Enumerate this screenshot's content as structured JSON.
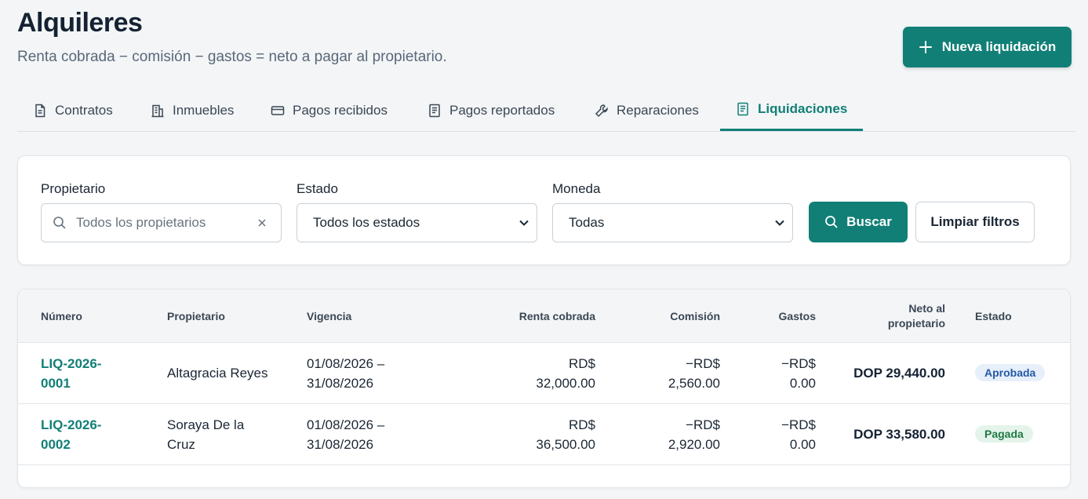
{
  "header": {
    "title": "Alquileres",
    "subtitle": "Renta cobrada − comisión − gastos = neto a pagar al propietario.",
    "primary_button": "Nueva liquidación"
  },
  "tabs": [
    {
      "label": "Contratos",
      "icon": "document-icon"
    },
    {
      "label": "Inmuebles",
      "icon": "building-icon"
    },
    {
      "label": "Pagos recibidos",
      "icon": "credit-card-icon"
    },
    {
      "label": "Pagos reportados",
      "icon": "report-icon"
    },
    {
      "label": "Reparaciones",
      "icon": "wrench-icon"
    },
    {
      "label": "Liquidaciones",
      "icon": "receipt-icon",
      "active": true
    }
  ],
  "filters": {
    "owner_label": "Propietario",
    "owner_placeholder": "Todos los propietarios",
    "status_label": "Estado",
    "status_value": "Todos los estados",
    "currency_label": "Moneda",
    "currency_value": "Todas",
    "search_button": "Buscar",
    "clear_button": "Limpiar filtros"
  },
  "table": {
    "headers": {
      "number": "Número",
      "owner": "Propietario",
      "period": "Vigencia",
      "rent": "Renta cobrada",
      "commission": "Comisión",
      "expenses": "Gastos",
      "net_line1": "Neto al",
      "net_line2": "propietario",
      "status": "Estado"
    },
    "rows": [
      {
        "number_l1": "LIQ-2026-",
        "number_l2": "0001",
        "owner_l1": "Altagracia Reyes",
        "owner_l2": "",
        "period_l1": "01/08/2026 –",
        "period_l2": "31/08/2026",
        "rent_l1": "RD$",
        "rent_l2": "32,000.00",
        "commission_l1": "−RD$",
        "commission_l2": "2,560.00",
        "expenses_l1": "−RD$",
        "expenses_l2": "0.00",
        "net": "DOP 29,440.00",
        "status": "Aprobada",
        "status_color": "#2459a6"
      },
      {
        "number_l1": "LIQ-2026-",
        "number_l2": "0002",
        "owner_l1": "Soraya De la",
        "owner_l2": "Cruz",
        "period_l1": "01/08/2026 –",
        "period_l2": "31/08/2026",
        "rent_l1": "RD$",
        "rent_l2": "36,500.00",
        "commission_l1": "−RD$",
        "commission_l2": "2,920.00",
        "expenses_l1": "−RD$",
        "expenses_l2": "0.00",
        "net": "DOP 33,580.00",
        "status": "Pagada",
        "status_color": "#1f7a44"
      }
    ]
  },
  "colors": {
    "accent": "#117f76",
    "background": "#f3f5f7"
  }
}
